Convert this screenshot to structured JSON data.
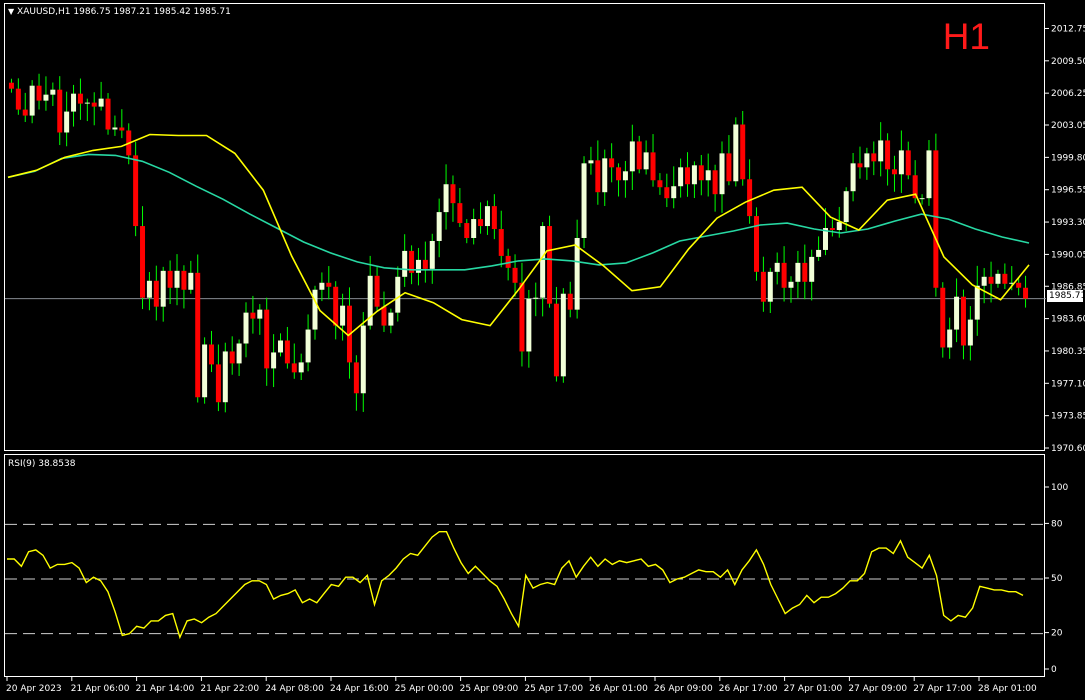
{
  "header": {
    "symbol_tf": "XAUUSD,H1",
    "ohlc": "1986.75 1987.21 1985.42 1985.71",
    "timeframe_badge": "H1",
    "current_price": "1985.71"
  },
  "rsi": {
    "label": "RSI(9) 38.8538"
  },
  "colors": {
    "background": "#000000",
    "bull_candle": "#f2ffd8",
    "bear_candle": "#ff0000",
    "wick": "#00ff00",
    "fast_ma": "#ffff00",
    "slow_ma": "#27d8a3",
    "rsi_line": "#ffff00",
    "frame": "#ffffff",
    "badge": "#ff1a1a"
  },
  "chart_data": [
    {
      "type": "candlestick",
      "title": "XAUUSD,H1",
      "ylim": [
        1970.6,
        2013.5
      ],
      "y_ticks": [
        "2012.75",
        "2009.50",
        "2006.25",
        "2003.05",
        "1999.80",
        "1996.55",
        "1993.30",
        "1990.05",
        "1986.85",
        "1983.60",
        "1980.35",
        "1977.10",
        "1973.85",
        "1970.60"
      ],
      "x_ticks": [
        "20 Apr 2023",
        "21 Apr 06:00",
        "21 Apr 14:00",
        "21 Apr 22:00",
        "24 Apr 08:00",
        "24 Apr 16:00",
        "25 Apr 00:00",
        "25 Apr 09:00",
        "25 Apr 17:00",
        "26 Apr 01:00",
        "26 Apr 09:00",
        "26 Apr 17:00",
        "27 Apr 01:00",
        "27 Apr 09:00",
        "27 Apr 17:00",
        "28 Apr 01:00"
      ],
      "series": [
        {
          "name": "close",
          "values": [
            2006.8,
            2004.7,
            2004.1,
            2007.1,
            2005.6,
            2006.2,
            2006.7,
            2002.4,
            2004.5,
            2006.3,
            2005.3,
            2005.4,
            2005.0,
            2005.8,
            2002.7,
            2002.9,
            2002.6,
            2000.1,
            1993.0,
            1985.8,
            1987.5,
            1984.9,
            1988.5,
            1986.8,
            1988.5,
            1986.6,
            1988.3,
            1975.8,
            1981.1,
            1979.1,
            1975.3,
            1980.4,
            1979.2,
            1981.2,
            1984.3,
            1983.7,
            1984.6,
            1978.7,
            1980.3,
            1981.5,
            1979.2,
            1978.3,
            1979.3,
            1982.6,
            1986.6,
            1987.3,
            1986.9,
            1983.0,
            1985.0,
            1979.3,
            1976.2,
            1983.0,
            1988.0,
            1984.9,
            1983.0,
            1984.3,
            1987.9,
            1990.5,
            1988.3,
            1989.6,
            1988.7,
            1991.5,
            1994.4,
            1997.2,
            1995.3,
            1993.3,
            1991.8,
            1993.7,
            1993.0,
            1995.0,
            1992.7,
            1990.0,
            1988.8,
            1987.3,
            1980.4,
            1985.7,
            1985.8,
            1993.0,
            1985.2,
            1977.9,
            1986.2,
            1984.6,
            1991.8,
            1999.3,
            1999.6,
            1996.4,
            1999.8,
            1998.9,
            1997.6,
            1998.5,
            2001.5,
            1998.7,
            2000.4,
            1997.6,
            1996.9,
            1995.8,
            1997.0,
            1998.9,
            1997.2,
            1999.1,
            1997.6,
            1998.6,
            1996.2,
            2000.3,
            1997.5,
            2003.2,
            1997.7,
            1994.0,
            1988.4,
            1985.4,
            1988.4,
            1989.3,
            1986.8,
            1987.4,
            1989.3,
            1987.4,
            1989.9,
            1990.6,
            1992.8,
            1992.6,
            1993.4,
            1996.5,
            1999.3,
            1998.9,
            2000.3,
            1999.5,
            2001.6,
            1998.7,
            1998.2,
            2000.6,
            1998.1,
            1995.8,
            1995.8,
            2000.6,
            1986.8,
            1980.8,
            1982.6,
            1985.9,
            1981.0,
            1983.6,
            1987.0,
            1987.9,
            1987.2,
            1988.2,
            1987.2,
            1987.3,
            1986.8,
            1985.7
          ]
        },
        {
          "name": "fast MA",
          "values": [
            1997.9,
            1998.6,
            1999.9,
            2000.6,
            2001.0,
            2002.2,
            2002.1,
            2002.1,
            2000.3,
            1996.6,
            1990.0,
            1984.5,
            1982.0,
            1984.4,
            1986.3,
            1985.3,
            1983.6,
            1983.0,
            1986.6,
            1990.5,
            1991.1,
            1989.0,
            1986.5,
            1986.9,
            1990.7,
            1993.8,
            1995.4,
            1996.6,
            1996.9,
            1993.9,
            1992.6,
            1995.6,
            1996.2,
            1989.9,
            1987.1,
            1985.6,
            1989.1
          ]
        },
        {
          "name": "slow MA",
          "values": [
            1997.9,
            1998.5,
            1999.8,
            2000.2,
            2000.1,
            1999.5,
            1998.4,
            1997.0,
            1995.7,
            1994.2,
            1992.8,
            1991.4,
            1990.3,
            1989.4,
            1988.8,
            1988.6,
            1988.6,
            1988.6,
            1989.0,
            1989.5,
            1989.7,
            1989.5,
            1989.1,
            1989.3,
            1990.3,
            1991.5,
            1992.0,
            1992.5,
            1993.1,
            1993.3,
            1992.7,
            1992.3,
            1992.7,
            1993.5,
            1994.2,
            1993.7,
            1992.7,
            1991.9,
            1991.3
          ]
        }
      ]
    },
    {
      "type": "line",
      "title": "RSI(9) 38.8538",
      "ylim": [
        0,
        100
      ],
      "y_ticks": [
        "100",
        "80",
        "50",
        "20",
        "0"
      ],
      "series": [
        {
          "name": "RSI(9)",
          "values": [
            61,
            61,
            57,
            65,
            66,
            63,
            56,
            58,
            58,
            59,
            56,
            48,
            51,
            49,
            43,
            32,
            19,
            20,
            24,
            23,
            27,
            27,
            30,
            31,
            18,
            27,
            28,
            26,
            29,
            31,
            35,
            39,
            43,
            47,
            49,
            49,
            47,
            39,
            41,
            42,
            44,
            37,
            39,
            37,
            42,
            47,
            46,
            51,
            51,
            48,
            52,
            36,
            49,
            52,
            56,
            61,
            64,
            63,
            68,
            73,
            76,
            76,
            67,
            59,
            53,
            57,
            53,
            49,
            46,
            39,
            31,
            24,
            52,
            45,
            47,
            48,
            47,
            56,
            60,
            51,
            57,
            62,
            57,
            61,
            58,
            60,
            59,
            60,
            61,
            57,
            58,
            55,
            48,
            50,
            51,
            53,
            55,
            54,
            54,
            51,
            55,
            47,
            55,
            60,
            66,
            58,
            47,
            39,
            31,
            34,
            36,
            41,
            37,
            40,
            40,
            42,
            45,
            49,
            49,
            53,
            65,
            67,
            67,
            64,
            71,
            62,
            59,
            56,
            63,
            52,
            30,
            27,
            30,
            29,
            34,
            46,
            45,
            44,
            44,
            43,
            43,
            41
          ]
        }
      ]
    }
  ]
}
